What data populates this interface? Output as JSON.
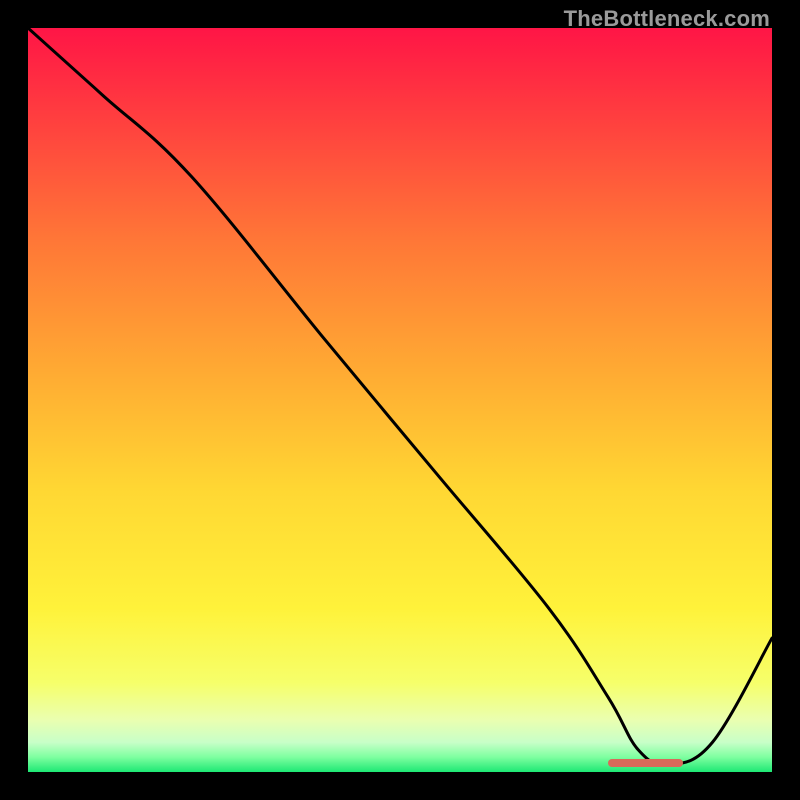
{
  "watermark": "TheBottleneck.com",
  "chart_data": {
    "type": "line",
    "title": "",
    "xlabel": "",
    "ylabel": "",
    "xlim": [
      0,
      100
    ],
    "ylim": [
      0,
      100
    ],
    "grid": false,
    "series": [
      {
        "name": "bottleneck-curve",
        "x": [
          0,
          10,
          22,
          40,
          55,
          70,
          78,
          82,
          86,
          92,
          100
        ],
        "y": [
          100,
          91,
          80,
          58,
          40,
          22,
          10,
          3,
          1,
          4,
          18
        ]
      }
    ],
    "marker": {
      "name": "optimal-range",
      "x_start": 78,
      "x_end": 88,
      "y": 1.2,
      "color": "#d96a5a"
    },
    "gradient_stops": [
      {
        "pct": 0,
        "color": "#ff1546"
      },
      {
        "pct": 12,
        "color": "#ff3e3f"
      },
      {
        "pct": 28,
        "color": "#ff7537"
      },
      {
        "pct": 45,
        "color": "#ffa733"
      },
      {
        "pct": 62,
        "color": "#ffd733"
      },
      {
        "pct": 78,
        "color": "#fff23a"
      },
      {
        "pct": 88,
        "color": "#f6ff6a"
      },
      {
        "pct": 93,
        "color": "#eaffb0"
      },
      {
        "pct": 96,
        "color": "#c8ffc8"
      },
      {
        "pct": 98,
        "color": "#7effa0"
      },
      {
        "pct": 100,
        "color": "#1de874"
      }
    ]
  }
}
